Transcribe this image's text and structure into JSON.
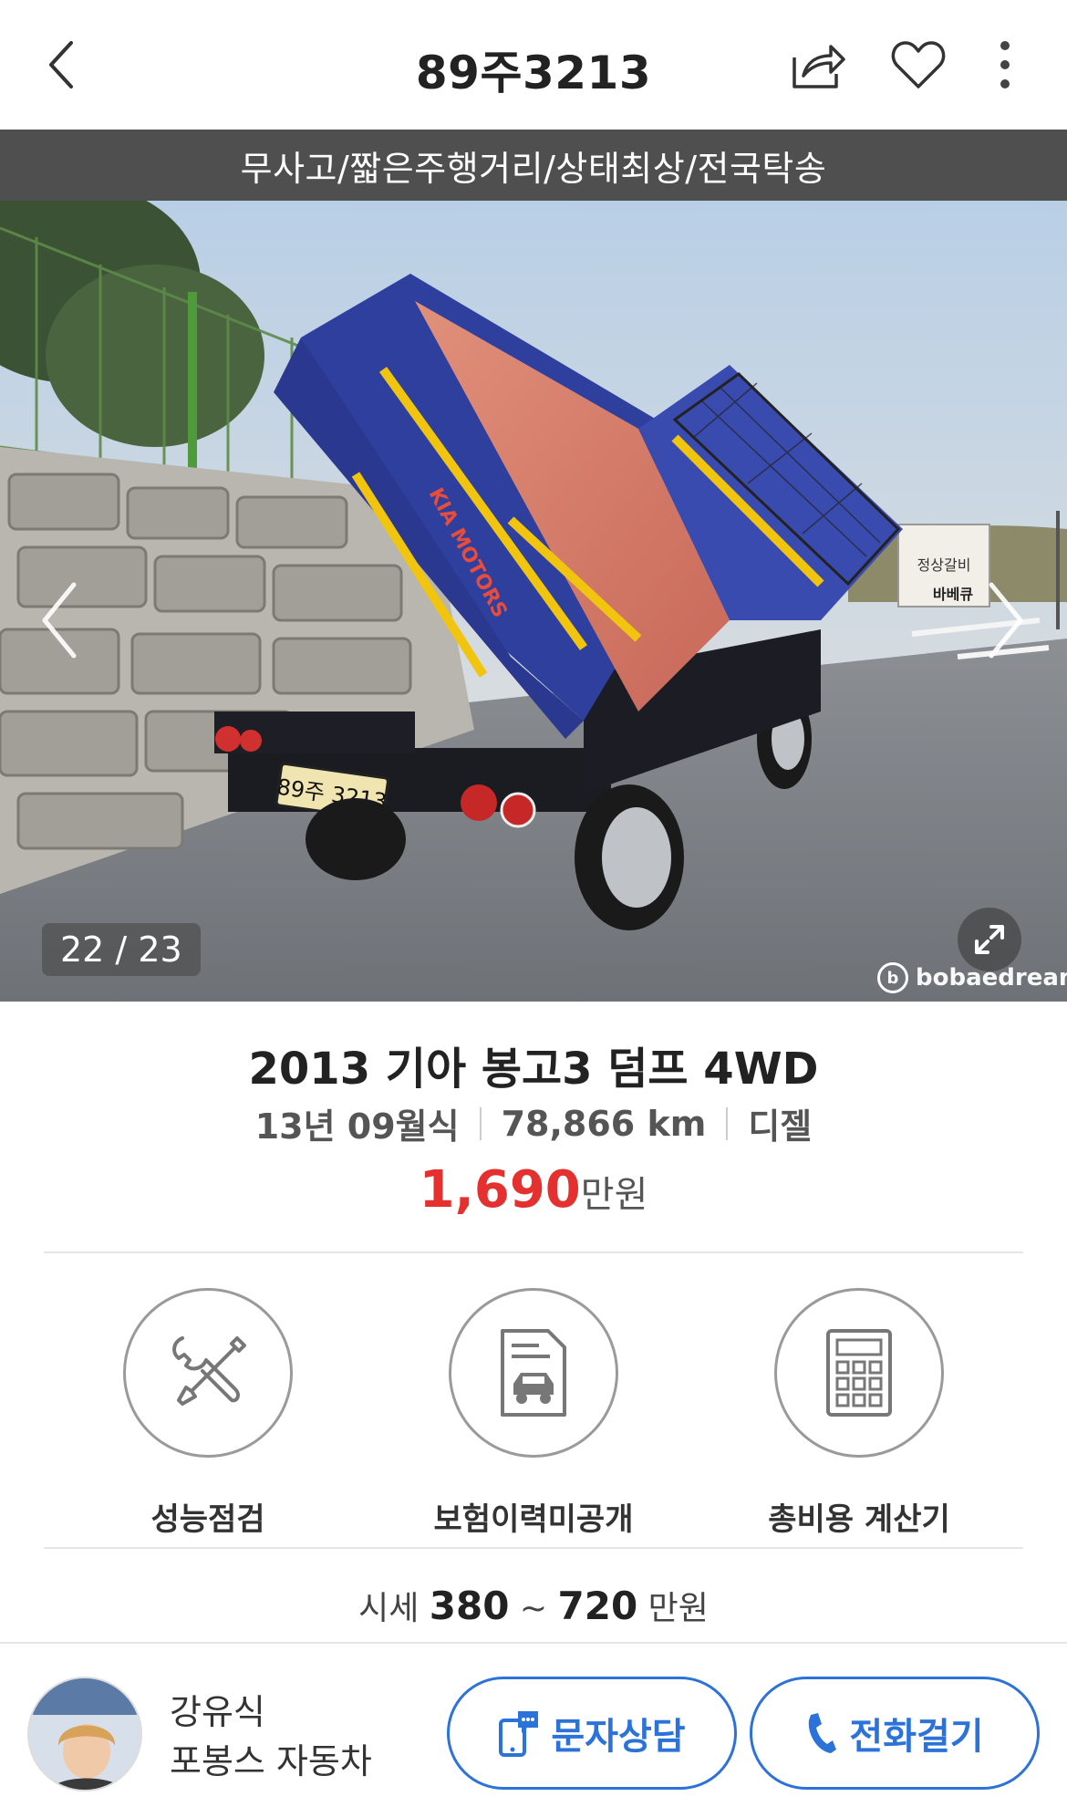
{
  "header": {
    "title": "89주3213",
    "icons": {
      "back": "chevron-left-icon",
      "share": "share-icon",
      "favorite": "heart-icon",
      "more": "more-vertical-icon"
    }
  },
  "banner": {
    "text": "무사고/짧은주행거리/상태최상/전국탁송"
  },
  "photo": {
    "counter": "22 / 23",
    "plate": "89주 3213",
    "brand_text": "KIA MOTORS",
    "watermark": "bobaedream",
    "sign_text": "정상갈비",
    "sign_text2": "바베큐"
  },
  "car": {
    "title": "2013 기아 봉고3 덤프 4WD",
    "year": "13년 09월식",
    "mileage": "78,866 km",
    "fuel": "디젤",
    "price": "1,690",
    "price_unit": "만원"
  },
  "features": [
    {
      "label": "성능점검",
      "icon": "tools-icon"
    },
    {
      "label": "보험이력미공개",
      "icon": "car-document-icon"
    },
    {
      "label": "총비용 계산기",
      "icon": "calculator-icon"
    }
  ],
  "market": {
    "prefix": "시세",
    "low": "380",
    "tilde": "~",
    "high": "720",
    "unit": "만원"
  },
  "dealer": {
    "name": "강유식",
    "shop": "포봉스 자동차"
  },
  "actions": {
    "sms": "문자상담",
    "call": "전화걸기"
  },
  "colors": {
    "accent": "#2c73d9",
    "price": "#e53030",
    "banner_bg": "#4f4f4f"
  }
}
